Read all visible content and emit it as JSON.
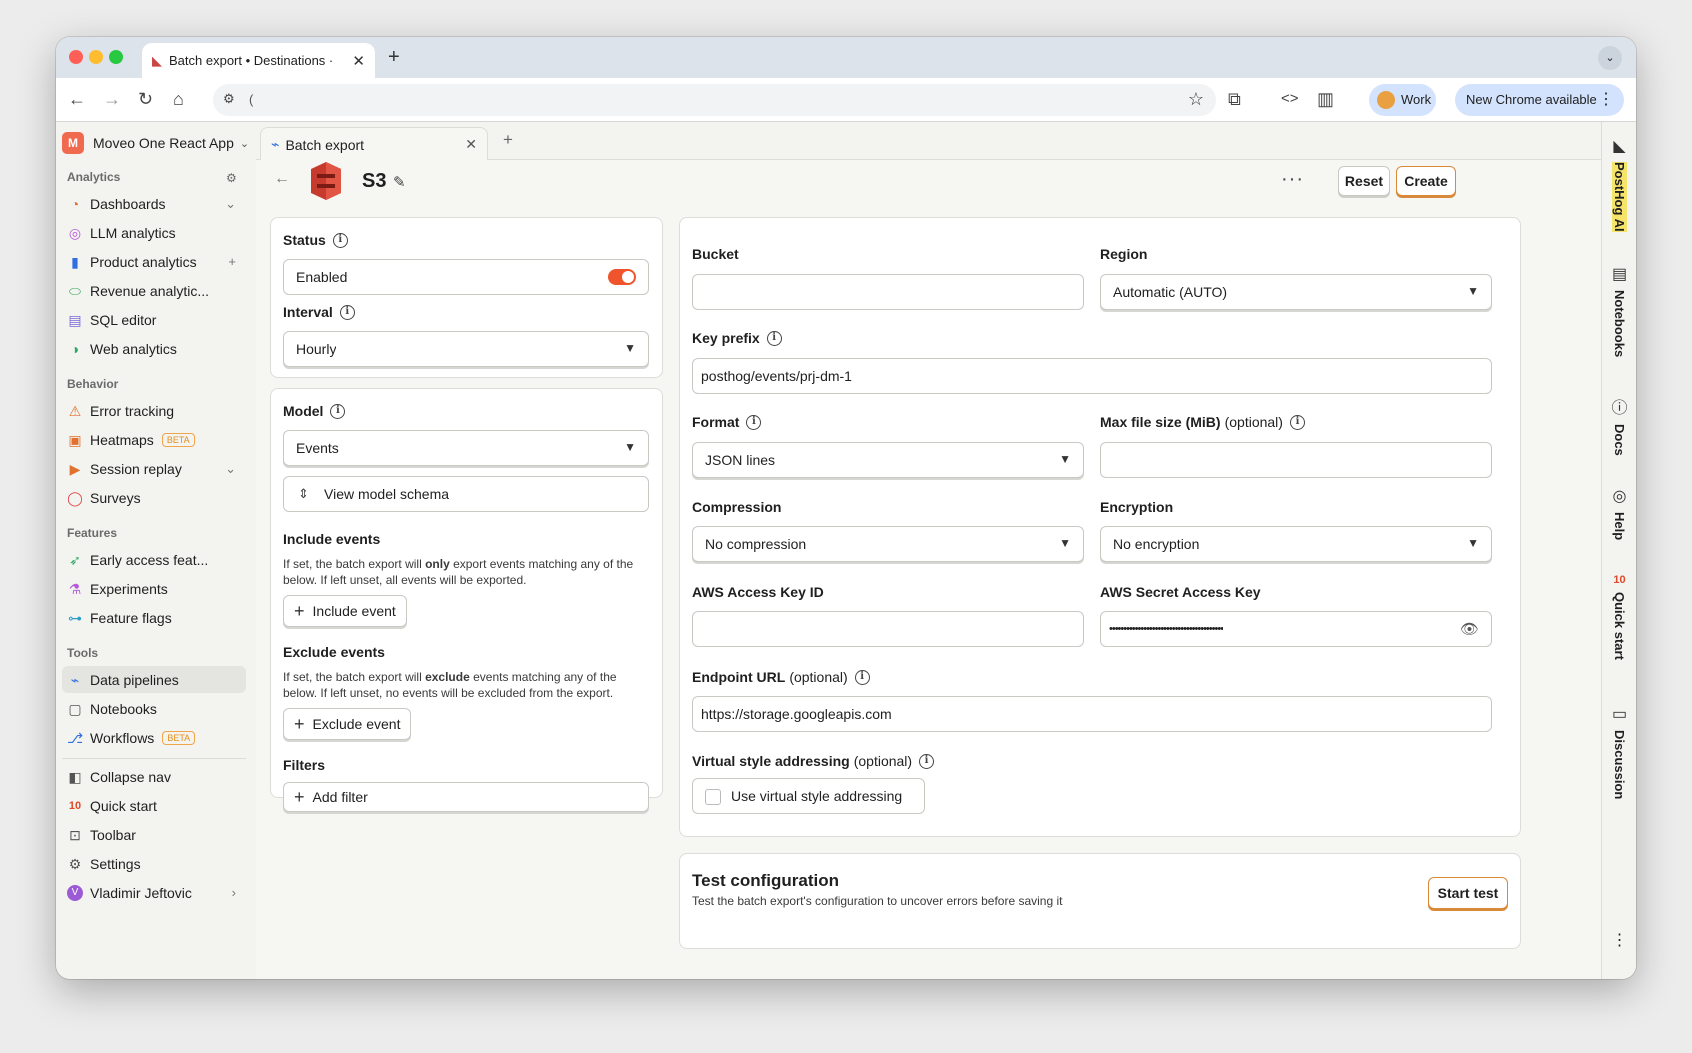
{
  "browser": {
    "tab_title": "Batch export • Destinations ·",
    "url": "(",
    "profile_label": "Work",
    "update_label": "New Chrome available"
  },
  "project": {
    "initial": "M",
    "name": "Moveo One React App"
  },
  "sidebar": {
    "analytics_title": "Analytics",
    "analytics": [
      "Dashboards",
      "LLM analytics",
      "Product analytics",
      "Revenue analytic...",
      "SQL editor",
      "Web analytics"
    ],
    "behavior_title": "Behavior",
    "behavior": [
      "Error tracking",
      "Heatmaps",
      "Session replay",
      "Surveys"
    ],
    "features_title": "Features",
    "features": [
      "Early access feat...",
      "Experiments",
      "Feature flags"
    ],
    "tools_title": "Tools",
    "tools": [
      "Data pipelines",
      "Notebooks",
      "Workflows"
    ],
    "beta_label": "BETA",
    "footer": [
      "Collapse nav",
      "Quick start",
      "Toolbar",
      "Settings"
    ],
    "user_initial": "V",
    "user_name": "Vladimir Jeftovic"
  },
  "app_tab": {
    "label": "Batch export"
  },
  "page": {
    "title": "S3",
    "reset_label": "Reset",
    "create_label": "Create"
  },
  "status_card": {
    "status_label": "Status",
    "enabled_label": "Enabled",
    "enabled": true,
    "interval_label": "Interval",
    "interval_value": "Hourly"
  },
  "model_card": {
    "model_label": "Model",
    "model_value": "Events",
    "view_schema_label": "View model schema",
    "include_title": "Include events",
    "include_hint_1": "If set, the batch export will ",
    "include_hint_bold": "only",
    "include_hint_2": " export events matching any of the below. If left unset, all events will be exported.",
    "include_button": "Include event",
    "exclude_title": "Exclude events",
    "exclude_hint_1": "If set, the batch export will ",
    "exclude_hint_bold": "exclude",
    "exclude_hint_2": " events matching any of the below. If left unset, no events will be excluded from the export.",
    "exclude_button": "Exclude event",
    "filters_title": "Filters",
    "add_filter_button": "Add filter"
  },
  "config": {
    "bucket_label": "Bucket",
    "bucket_value": "",
    "region_label": "Region",
    "region_value": "Automatic (AUTO)",
    "key_prefix_label": "Key prefix",
    "key_prefix_value": "posthog/events/prj-dm-1",
    "format_label": "Format",
    "format_value": "JSON lines",
    "max_file_label": "Max file size (MiB)",
    "optional": "(optional)",
    "max_file_value": "",
    "compression_label": "Compression",
    "compression_value": "No compression",
    "encryption_label": "Encryption",
    "encryption_value": "No encryption",
    "access_key_label": "AWS Access Key ID",
    "access_key_value": "",
    "secret_key_label": "AWS Secret Access Key",
    "secret_key_value": "••••••••••••••••••••••••••••••••••••••••",
    "endpoint_label": "Endpoint URL",
    "endpoint_value": "https://storage.googleapis.com",
    "virtual_label": "Virtual style addressing",
    "virtual_checkbox_label": "Use virtual style addressing",
    "virtual_checked": false
  },
  "test": {
    "title": "Test configuration",
    "description": "Test the batch export's configuration to uncover errors before saving it",
    "button": "Start test"
  },
  "right_sidebar": [
    "PostHog AI",
    "Notebooks",
    "Docs",
    "Help",
    "Quick start",
    "Discussion"
  ],
  "colors": {
    "toggle_on": "#f0542c",
    "accent": "#d9893a",
    "beta": "#e3901e"
  }
}
